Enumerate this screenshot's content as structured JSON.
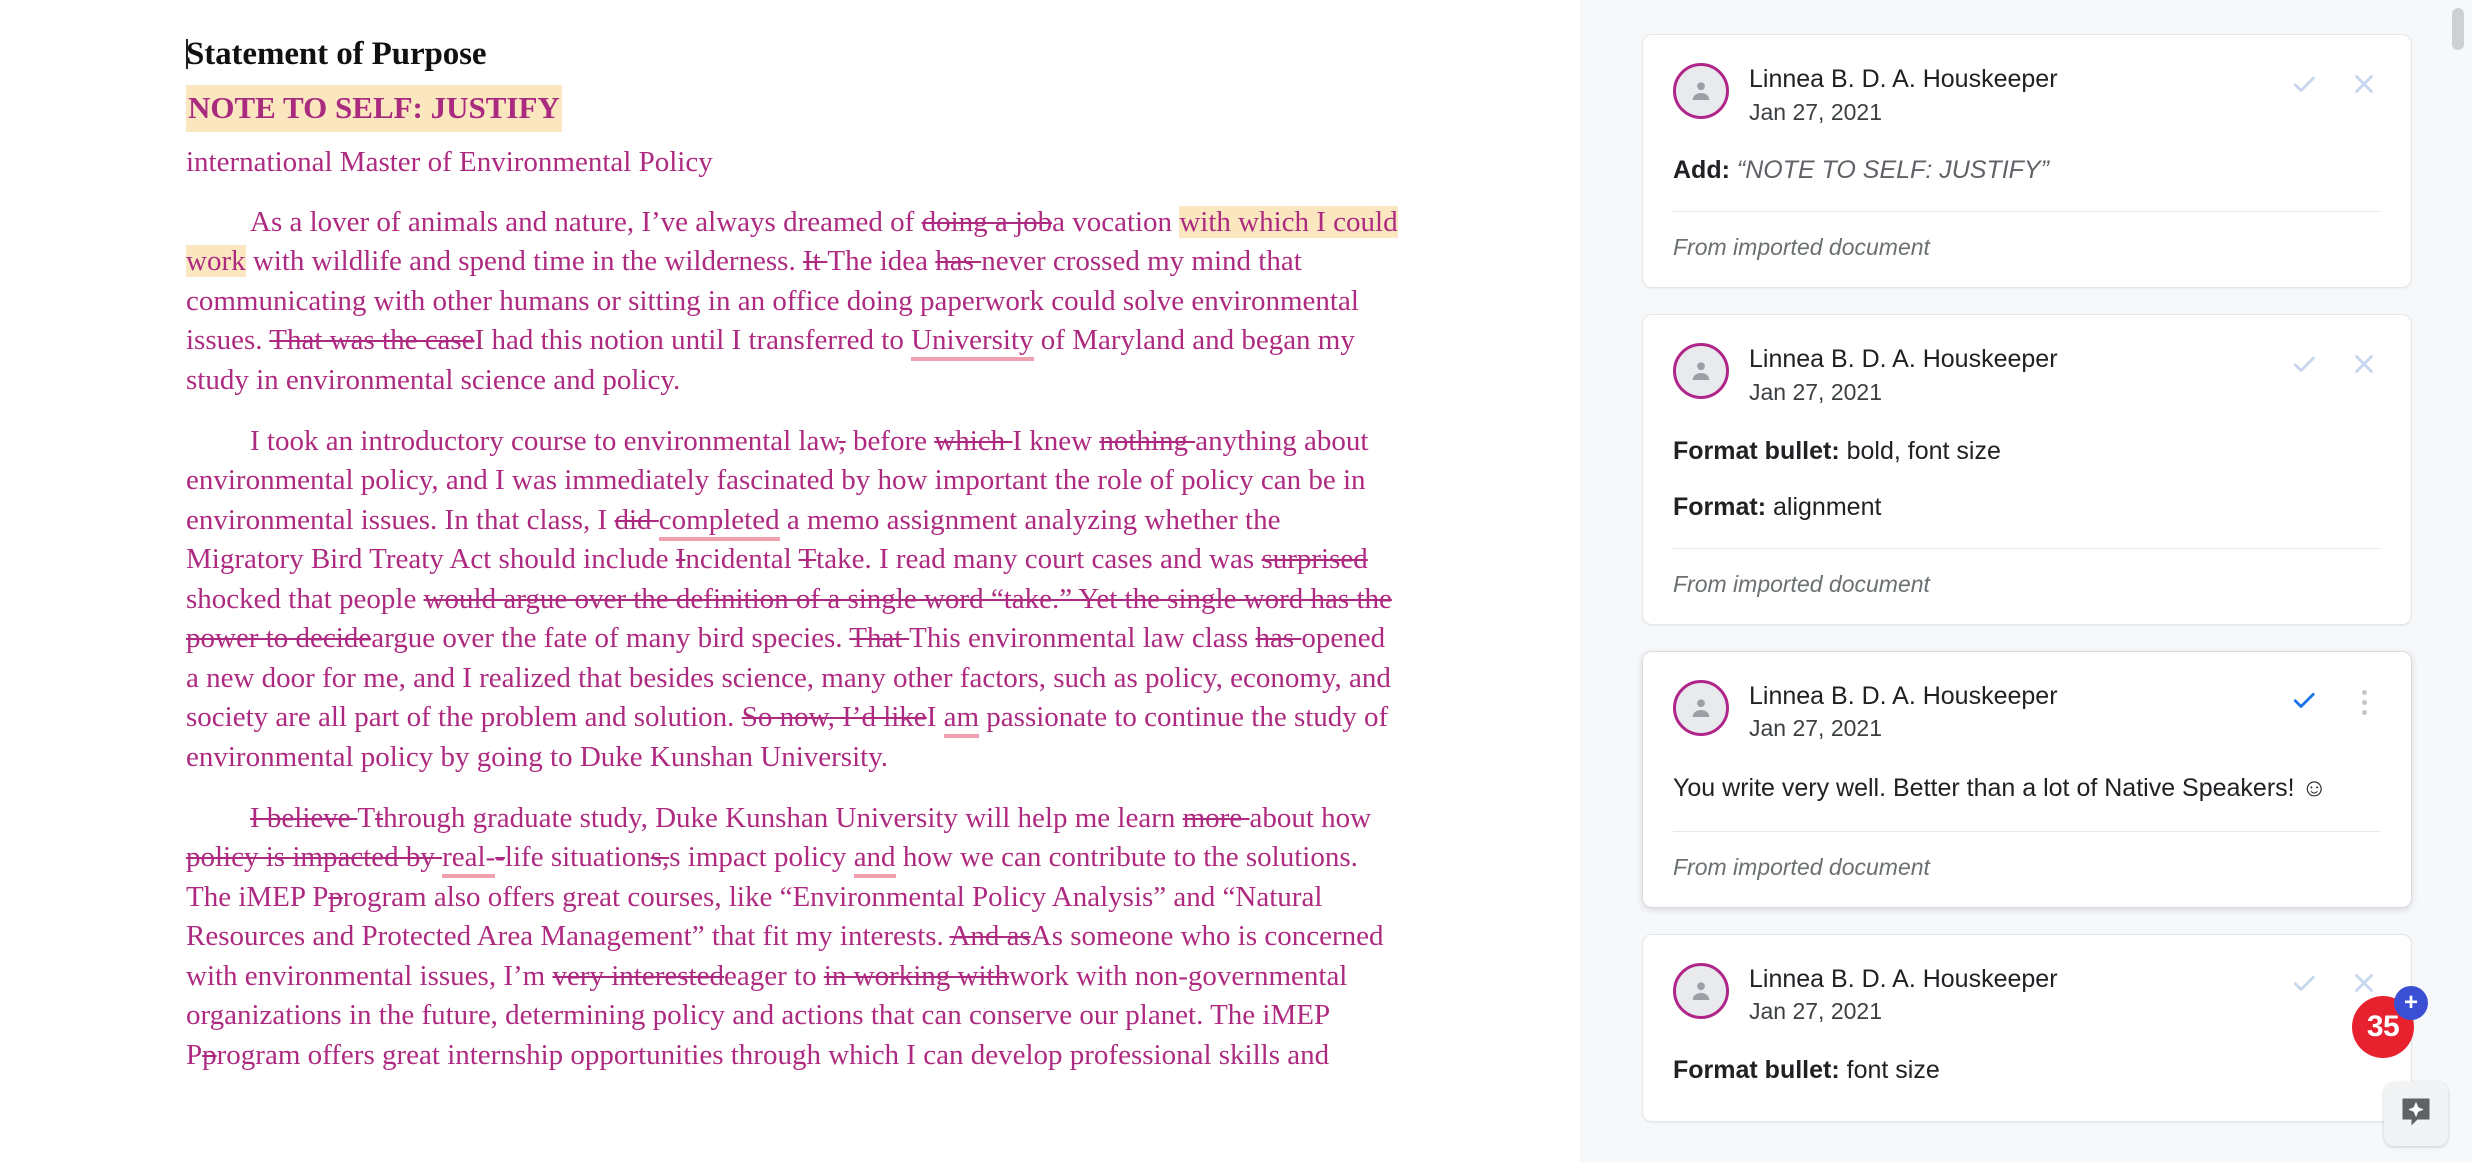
{
  "document": {
    "title": "Statement of Purpose",
    "note_heading": "NOTE TO SELF: JUSTIFY",
    "subtitle": "international Master of Environmental Policy",
    "paragraphs": [
      {
        "id": "p1",
        "runs": [
          {
            "t": "indent"
          },
          {
            "t": "text",
            "v": "As a lover of animals and nature, I’ve always dreamed of "
          },
          {
            "t": "del",
            "v": "doing a job"
          },
          {
            "t": "text",
            "v": "a vocation "
          },
          {
            "t": "hl",
            "v": "with which I could work"
          },
          {
            "t": "text",
            "v": " with wildlife and spend time in the wilderness. "
          },
          {
            "t": "del",
            "v": "It "
          },
          {
            "t": "text",
            "v": "The idea "
          },
          {
            "t": "del",
            "v": "has "
          },
          {
            "t": "text",
            "v": "never crossed my mind that communicating with other humans or sitting in an office doing paperwork could solve environmental issues. "
          },
          {
            "t": "del",
            "v": "That was the case"
          },
          {
            "t": "text",
            "v": "I had this notion until I transferred to "
          },
          {
            "t": "sp",
            "v": "University"
          },
          {
            "t": "text",
            "v": " of Maryland and began my study in environmental science and policy."
          }
        ]
      },
      {
        "id": "p2",
        "runs": [
          {
            "t": "indent"
          },
          {
            "t": "text",
            "v": "I took an introductory course to environmental law"
          },
          {
            "t": "del",
            "v": ","
          },
          {
            "t": "text",
            "v": " before "
          },
          {
            "t": "del",
            "v": "which "
          },
          {
            "t": "text",
            "v": "I knew "
          },
          {
            "t": "del",
            "v": "nothing "
          },
          {
            "t": "text",
            "v": "anything about environmental policy, and I was immediately fascinated by how important the role of policy can be in environmental issues. In that class, I "
          },
          {
            "t": "del",
            "v": "did "
          },
          {
            "t": "sp",
            "v": "completed"
          },
          {
            "t": "text",
            "v": " a memo assignment analyzing whether the Migratory Bird Treaty Act should include "
          },
          {
            "t": "del",
            "v": "I"
          },
          {
            "t": "text",
            "v": "ncidental "
          },
          {
            "t": "del",
            "v": "T"
          },
          {
            "t": "text",
            "v": "take. I read many court cases and was "
          },
          {
            "t": "del",
            "v": "surprised "
          },
          {
            "t": "text",
            "v": "shocked that people "
          },
          {
            "t": "del",
            "v": "would argue over the definition of a single word “take.” Yet the single word has the power to decide"
          },
          {
            "t": "text",
            "v": "argue over the fate of many bird species. "
          },
          {
            "t": "del",
            "v": "That "
          },
          {
            "t": "text",
            "v": "This environmental law class "
          },
          {
            "t": "del",
            "v": "has "
          },
          {
            "t": "text",
            "v": "opened a new door for me, and I realized that besides science, many other factors, such as policy, economy, and society are all part of the problem and solution. "
          },
          {
            "t": "del",
            "v": "So now, I’d like"
          },
          {
            "t": "text",
            "v": "I "
          },
          {
            "t": "sp",
            "v": "am"
          },
          {
            "t": "text",
            "v": " passionate to continue the study of environmental policy by going to Duke Kunshan University."
          }
        ]
      },
      {
        "id": "p3",
        "runs": [
          {
            "t": "indent"
          },
          {
            "t": "del",
            "v": "I believe "
          },
          {
            "t": "text",
            "v": "T"
          },
          {
            "t": "del",
            "v": "t"
          },
          {
            "t": "text",
            "v": "hrough graduate study, Duke Kunshan University will help me learn "
          },
          {
            "t": "del",
            "v": "more "
          },
          {
            "t": "text",
            "v": "about how "
          },
          {
            "t": "del",
            "v": "policy is impacted by "
          },
          {
            "t": "sp",
            "v": "real-"
          },
          {
            "t": "del",
            "v": "-"
          },
          {
            "t": "text",
            "v": "life situation"
          },
          {
            "t": "del",
            "v": "s,"
          },
          {
            "t": "text",
            "v": "s impact policy "
          },
          {
            "t": "sp",
            "v": "and"
          },
          {
            "t": "text",
            "v": " how we can contribute to the solutions. The iMEP "
          },
          {
            "t": "text",
            "v": "P"
          },
          {
            "t": "del",
            "v": "p"
          },
          {
            "t": "text",
            "v": "rogram also offers great courses, like “Environmental Policy Analysis” and “Natural Resources and Protected Area Management” that fit my interests. "
          },
          {
            "t": "del",
            "v": "And as"
          },
          {
            "t": "text",
            "v": "As someone who is concerned with environmental issues, I’m "
          },
          {
            "t": "del",
            "v": "very interested"
          },
          {
            "t": "text",
            "v": "eager to "
          },
          {
            "t": "del",
            "v": "in working with"
          },
          {
            "t": "text",
            "v": "work with non-governmental organizations in the future, determining policy and actions that can conserve our planet. The iMEP "
          },
          {
            "t": "text",
            "v": "P"
          },
          {
            "t": "del",
            "v": "p"
          },
          {
            "t": "text",
            "v": "rogram offers great internship opportunities through which I can develop professional skills and"
          }
        ]
      }
    ]
  },
  "panel": {
    "cards": [
      {
        "author": "Linnea B. D. A. Houskeeper",
        "date": "Jan 27, 2021",
        "active": false,
        "lines": [
          {
            "label": "Add:",
            "value": "“NOTE TO SELF: JUSTIFY”",
            "italic": true
          }
        ],
        "comment": null,
        "footer": "From imported document",
        "accept_icon": "check-icon",
        "reject_icon": "close-icon"
      },
      {
        "author": "Linnea B. D. A. Houskeeper",
        "date": "Jan 27, 2021",
        "active": false,
        "lines": [
          {
            "label": "Format bullet:",
            "value": "bold, font size",
            "italic": false
          },
          {
            "label": "Format:",
            "value": "alignment",
            "italic": false
          }
        ],
        "comment": null,
        "footer": "From imported document",
        "accept_icon": "check-icon",
        "reject_icon": "close-icon"
      },
      {
        "author": "Linnea B. D. A. Houskeeper",
        "date": "Jan 27, 2021",
        "active": true,
        "lines": [],
        "comment": "You write very well. Better than a lot of Native Speakers! ☺",
        "footer": "From imported document",
        "accept_icon": "check-icon",
        "reject_icon": "more-vertical-icon"
      },
      {
        "author": "Linnea B. D. A. Houskeeper",
        "date": "Jan 27, 2021",
        "active": false,
        "lines": [
          {
            "label": "Format bullet:",
            "value": "font size",
            "italic": false
          }
        ],
        "comment": null,
        "footer": null,
        "accept_icon": "check-icon",
        "reject_icon": "close-icon"
      }
    ]
  },
  "floating": {
    "badge_count": "35",
    "badge_plus": "+",
    "fab_icon": "comment-sparkle-icon"
  },
  "colors": {
    "tracked_change": "#ae2a80",
    "highlight": "#fbe7bf",
    "spellcheck_underline": "#f0a0ae",
    "accept_active": "#1a73e8",
    "avatar_ring": "#b0258a",
    "badge_red": "#e8212f",
    "badge_blue": "#3b4fd4",
    "panel_bg": "#f6f8fa"
  }
}
